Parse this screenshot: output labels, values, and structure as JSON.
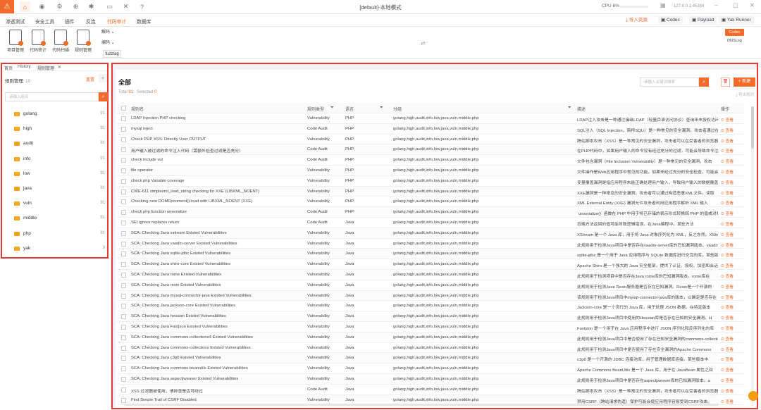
{
  "window": {
    "title": "[default]-本地模式",
    "cpu_label": "CPU 6%",
    "ip": "127.0.0.1:45384"
  },
  "top_icons": [
    "home-icon",
    "user-icon",
    "gear-icon",
    "globe-icon",
    "bug-icon",
    "terminal-icon",
    "tools-icon",
    "help-icon"
  ],
  "menu": {
    "items": [
      "渗透测试",
      "安全工具",
      "插件",
      "反连",
      "代码审计",
      "数据库"
    ],
    "active_index": 4
  },
  "right_tools": {
    "import_label": "导入资源",
    "codec_label": "Codec",
    "payload_label": "Payload",
    "runner_label": "Yak Runner"
  },
  "toolbar": {
    "tools": [
      "项目管理",
      "代码审计",
      "代码扫描",
      "规则管理"
    ],
    "decode_label": "解码",
    "encode_label": "编码",
    "fuzztag_label": "fuzztag",
    "codec_button": "Codec",
    "dnslog_label": "DNSLog"
  },
  "left": {
    "tabs": [
      "首页",
      "History",
      "规则管理"
    ],
    "active_tab": 2,
    "title": "规则管理",
    "count": "10",
    "reset_label": "重置",
    "search_placeholder": "请输入组名",
    "groups": [
      {
        "name": "golang",
        "count": "91"
      },
      {
        "name": "high",
        "count": "91"
      },
      {
        "name": "audit",
        "count": "91"
      },
      {
        "name": "info",
        "count": "91"
      },
      {
        "name": "low",
        "count": "91"
      },
      {
        "name": "java",
        "count": "91"
      },
      {
        "name": "vuln",
        "count": "91"
      },
      {
        "name": "middle",
        "count": "91"
      },
      {
        "name": "php",
        "count": "91"
      },
      {
        "name": "yak",
        "count": "0"
      }
    ]
  },
  "main": {
    "title": "全部",
    "total_label": "Total",
    "total": "91",
    "selected_label": "Selected",
    "selected": "0",
    "search_placeholder": "请输入关键词搜索",
    "new_label": "+ 新建",
    "import_label": "导出规则",
    "columns": {
      "name": "规则名",
      "type": "规则类型",
      "lang": "语言",
      "group": "分组",
      "desc": "描述",
      "op": "操作"
    },
    "view_label": "查看",
    "rows": [
      {
        "name": "LDAP Injection PHP checking",
        "type": "Vulnerability",
        "lang": "PHP",
        "group": "golang,high,audit,info,low,java,vuln,middle,php",
        "desc": "LDAP注入攻击是一种通过操纵LDAP（轻量目录访问协议）查询来未授权访问"
      },
      {
        "name": "mysql inject",
        "type": "Code Audit",
        "lang": "PHP",
        "group": "golang,high,audit,info,low,java,vuln,middle,php",
        "desc": "SQL注入（SQL Injection，简称SQLi）是一种常见的安全漏洞，攻击者通过在"
      },
      {
        "name": "Check PHP XSS: Directly User OUTPUT",
        "type": "Vulnerability",
        "lang": "PHP",
        "group": "golang,high,audit,info,low,java,vuln,middle,php",
        "desc": "跨站脚本攻击（XSS）是一种常见的安全漏洞，攻击者可以在受害者的浏览器中"
      },
      {
        "name": "用户输入被过滤的命令注入代码（需额外检查过滤是否充分）",
        "type": "Code Audit",
        "lang": "PHP",
        "group": "golang,high,audit,info,low,java,vuln,middle,php",
        "desc": "在PHP代码中，如果用户输入的命令没有经过充分的过滤，可能会导致命令注入漏洞"
      },
      {
        "name": "check include vul",
        "type": "Code Audit",
        "lang": "PHP",
        "group": "golang,high,audit,info,low,java,vuln,middle,php",
        "desc": "文件包含漏洞（File Inclusion Vulnerability）是一种常见的安全漏洞，攻击"
      },
      {
        "name": "file operator",
        "type": "Vulnerability",
        "lang": "PHP",
        "group": "golang,high,audit,info,low,java,vuln,middle,php",
        "desc": "文件操作是Web应用程序中常见的功能，如果未经过充分的安全检查，可能会导致"
      },
      {
        "name": "check php Variable coverage",
        "type": "Vulnerability",
        "lang": "PHP",
        "group": "golang,high,audit,info,low,java,vuln,middle,php",
        "desc": "变量覆盖漏洞是指应用程序未能正确处理用户输入，导致用户输入的数据覆盖了"
      },
      {
        "name": "CWE-611 simplexml_load_string checking for XXE (LIBXML_NOENT)",
        "type": "Vulnerability",
        "lang": "PHP",
        "group": "golang,high,audit,info,low,java,vuln,middle,php",
        "desc": "XXE漏洞是一种常见的安全漏洞，攻击者可以通过构造恶意XML文件，读取"
      },
      {
        "name": "Checking new DOMDocument()-load with LIBXML_NOENT (XXE)",
        "type": "Vulnerability",
        "lang": "PHP",
        "group": "golang,high,audit,info,low,java,vuln,middle,php",
        "desc": "XML External Entity (XXE) 漏洞允许攻击者利用应用程序解析 XML 输入"
      },
      {
        "name": "check php function unserialize",
        "type": "Code Audit",
        "lang": "PHP",
        "group": "golang,high,audit,info,low,java,vuln,middle,php",
        "desc": "`unserialize()` 函数在 PHP 中用于将已存储的表示形式转换回 PHP 的值或对象"
      },
      {
        "name": "SEI ignore replaces return",
        "type": "Code Audit",
        "lang": "Java",
        "group": "golang,high,audit,info,low,java,vuln,middle,php",
        "desc": "忽略方法返回的值可能导致逻辑错误，在Java编程中，某些方法"
      },
      {
        "name": "SCA: Checking Java xstream Existed Vulnerabilities",
        "type": "Vulnerability",
        "lang": "Java",
        "group": "golang,high,audit,info,low,java,vuln,middle,php",
        "desc": "XStream 是一个 Java 库，用于将 Java 对象序列化为 XML，反之亦然。XStream"
      },
      {
        "name": "SCA: Checking Java vaadin-server Existed Vulnerabilities",
        "type": "Vulnerability",
        "lang": "Java",
        "group": "golang,high,audit,info,low,java,vuln,middle,php",
        "desc": "此规则用于检测Java项目中是否存在vaadin-server库的已知漏洞版本。vaadin"
      },
      {
        "name": "SCA: Checking Java sqlite-jdbc Existed Vulnerabilities",
        "type": "Vulnerability",
        "lang": "Java",
        "group": "golang,high,audit,info,low,java,vuln,middle,php",
        "desc": "sqlite-jdbc 是一个用于 Java 应用程序与 SQLite 数据库进行交互的库，某些版本"
      },
      {
        "name": "SCA: Checking Java shiro-core Existed Vulnerabilities",
        "type": "Vulnerability",
        "lang": "Java",
        "group": "golang,high,audit,info,low,java,vuln,middle,php",
        "desc": "Apache Shiro 是一个强大的 Java 安全框架，提供了认证、授权、加密和会话管理"
      },
      {
        "name": "SCA: Checking Java rome Existed Vulnerabilities",
        "type": "Vulnerability",
        "lang": "Java",
        "group": "golang,high,audit,info,low,java,vuln,middle,php",
        "desc": "此规则用于检测项目中是否存在Java rome库的已知漏洞版本。rome库在"
      },
      {
        "name": "SCA: Checking Java resin Existed Vulnerabilities",
        "type": "Vulnerability",
        "lang": "Java",
        "group": "golang,high,audit,info,low,java,vuln,middle,php",
        "desc": "此规则用于检测Java Resin服务器是否存在已知漏洞。Resin是一个开源的"
      },
      {
        "name": "SCA: Checking Java mysql-connector-java Existed Vulnerabilities",
        "type": "Vulnerability",
        "lang": "Java",
        "group": "golang,high,audit,info,low,java,vuln,middle,php",
        "desc": "该规则用于检测Java项目中mysql-connector-java库的版本，以确定是否存在"
      },
      {
        "name": "SCA: Checking Java jackson-core Existed Vulnerabilities",
        "type": "Vulnerability",
        "lang": "Java",
        "group": "golang,high,audit,info,low,java,vuln,middle,php",
        "desc": "Jackson-core 是一个流行的 Java 库，用于处理 JSON 数据。在特定版本"
      },
      {
        "name": "SCA: Checking Java hessian Existed Vulnerabilities",
        "type": "Vulnerability",
        "lang": "Java",
        "group": "golang,high,audit,info,low,java,vuln,middle,php",
        "desc": "此规则用于检测Java项目中使用的Hessian库是否存在已知的安全漏洞。H"
      },
      {
        "name": "SCA: Checking Java Fastjson Existed Vulnerabilities",
        "type": "Vulnerability",
        "lang": "Java",
        "group": "golang,high,audit,info,low,java,vuln,middle,php",
        "desc": "Fastjson 是一个用于在 Java 应用程序中进行 JSON 序列化和反序列化的库"
      },
      {
        "name": "SCA: Checking Java commons-collections4 Existed Vulnerabilities",
        "type": "Vulnerability",
        "lang": "Java",
        "group": "golang,high,audit,info,low,java,vuln,middle,php",
        "desc": "此规则用于检测Java项目中是否使用了存在已知安全漏洞的commons-collections4"
      },
      {
        "name": "SCA: Checking Java commons-collections Existed Vulnerabilities",
        "type": "Vulnerability",
        "lang": "Java",
        "group": "golang,high,audit,info,low,java,vuln,middle,php",
        "desc": "此规则用于检测Java项目中是否使用了存在安全漏洞的Apache Commons"
      },
      {
        "name": "SCA: Checking Java c3p0 Existed Vulnerabilities",
        "type": "Vulnerability",
        "lang": "Java",
        "group": "golang,high,audit,info,low,java,vuln,middle,php",
        "desc": "c3p0 是一个开源的 JDBC 连接池库，用于管理数据库连接。某些版本中"
      },
      {
        "name": "SCA: Checking Java commons-beanutils Existed Vulnerabilities",
        "type": "Vulnerability",
        "lang": "Java",
        "group": "golang,high,audit,info,low,java,vuln,middle,php",
        "desc": "Apache Commons BeanUtils 是一个 Java 库，用于在 JavaBean 属性之间"
      },
      {
        "name": "SCA: Checking Java aspectjweaver Existed Vulnerabilities",
        "type": "Vulnerability",
        "lang": "Java",
        "group": "golang,high,audit,info,low,java,vuln,middle,php",
        "desc": "此规则用于检测Java项目中是否存在aspectjweaver库的已知漏洞版本。a"
      },
      {
        "name": "XSS 过滤器被使用，请排查是否可绕过",
        "type": "Code Audit",
        "lang": "Java",
        "group": "golang,high,audit,info,low,java,vuln,middle,php",
        "desc": "跨站脚本攻击（XSS）是一种常见的安全漏洞，攻击者可以在受害者的浏览器中"
      },
      {
        "name": "Find Simple Trail of CSRF Disabled",
        "type": "Vulnerability",
        "lang": "Java",
        "group": "golang,high,audit,info,low,java,vuln,middle,php",
        "desc": "禁用CSRF（跨站请求伪造）保护可能会使应用程序容易受到CSRF攻击。"
      }
    ]
  }
}
